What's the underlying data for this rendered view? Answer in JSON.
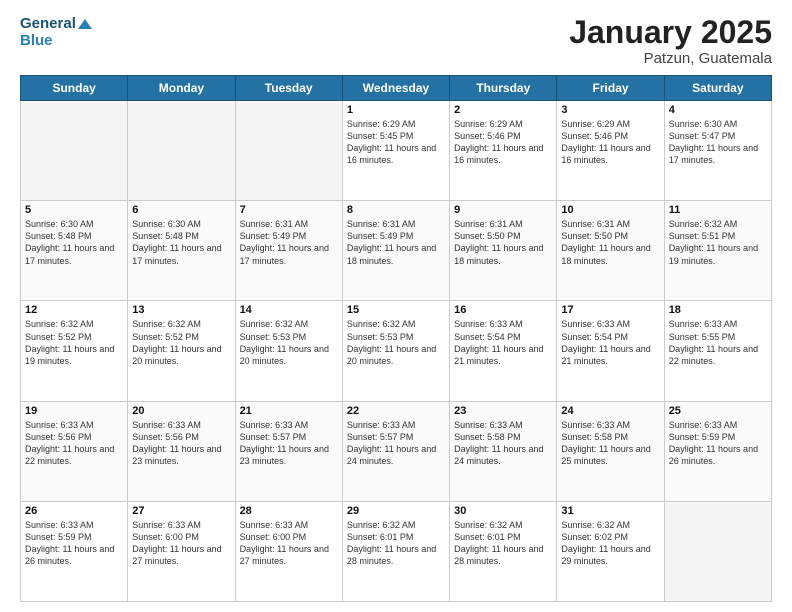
{
  "header": {
    "logo_line1": "General",
    "logo_line2": "Blue",
    "month": "January 2025",
    "location": "Patzun, Guatemala"
  },
  "weekdays": [
    "Sunday",
    "Monday",
    "Tuesday",
    "Wednesday",
    "Thursday",
    "Friday",
    "Saturday"
  ],
  "weeks": [
    [
      {
        "day": "",
        "text": ""
      },
      {
        "day": "",
        "text": ""
      },
      {
        "day": "",
        "text": ""
      },
      {
        "day": "1",
        "text": "Sunrise: 6:29 AM\nSunset: 5:45 PM\nDaylight: 11 hours\nand 16 minutes."
      },
      {
        "day": "2",
        "text": "Sunrise: 6:29 AM\nSunset: 5:46 PM\nDaylight: 11 hours\nand 16 minutes."
      },
      {
        "day": "3",
        "text": "Sunrise: 6:29 AM\nSunset: 5:46 PM\nDaylight: 11 hours\nand 16 minutes."
      },
      {
        "day": "4",
        "text": "Sunrise: 6:30 AM\nSunset: 5:47 PM\nDaylight: 11 hours\nand 17 minutes."
      }
    ],
    [
      {
        "day": "5",
        "text": "Sunrise: 6:30 AM\nSunset: 5:48 PM\nDaylight: 11 hours\nand 17 minutes."
      },
      {
        "day": "6",
        "text": "Sunrise: 6:30 AM\nSunset: 5:48 PM\nDaylight: 11 hours\nand 17 minutes."
      },
      {
        "day": "7",
        "text": "Sunrise: 6:31 AM\nSunset: 5:49 PM\nDaylight: 11 hours\nand 17 minutes."
      },
      {
        "day": "8",
        "text": "Sunrise: 6:31 AM\nSunset: 5:49 PM\nDaylight: 11 hours\nand 18 minutes."
      },
      {
        "day": "9",
        "text": "Sunrise: 6:31 AM\nSunset: 5:50 PM\nDaylight: 11 hours\nand 18 minutes."
      },
      {
        "day": "10",
        "text": "Sunrise: 6:31 AM\nSunset: 5:50 PM\nDaylight: 11 hours\nand 18 minutes."
      },
      {
        "day": "11",
        "text": "Sunrise: 6:32 AM\nSunset: 5:51 PM\nDaylight: 11 hours\nand 19 minutes."
      }
    ],
    [
      {
        "day": "12",
        "text": "Sunrise: 6:32 AM\nSunset: 5:52 PM\nDaylight: 11 hours\nand 19 minutes."
      },
      {
        "day": "13",
        "text": "Sunrise: 6:32 AM\nSunset: 5:52 PM\nDaylight: 11 hours\nand 20 minutes."
      },
      {
        "day": "14",
        "text": "Sunrise: 6:32 AM\nSunset: 5:53 PM\nDaylight: 11 hours\nand 20 minutes."
      },
      {
        "day": "15",
        "text": "Sunrise: 6:32 AM\nSunset: 5:53 PM\nDaylight: 11 hours\nand 20 minutes."
      },
      {
        "day": "16",
        "text": "Sunrise: 6:33 AM\nSunset: 5:54 PM\nDaylight: 11 hours\nand 21 minutes."
      },
      {
        "day": "17",
        "text": "Sunrise: 6:33 AM\nSunset: 5:54 PM\nDaylight: 11 hours\nand 21 minutes."
      },
      {
        "day": "18",
        "text": "Sunrise: 6:33 AM\nSunset: 5:55 PM\nDaylight: 11 hours\nand 22 minutes."
      }
    ],
    [
      {
        "day": "19",
        "text": "Sunrise: 6:33 AM\nSunset: 5:56 PM\nDaylight: 11 hours\nand 22 minutes."
      },
      {
        "day": "20",
        "text": "Sunrise: 6:33 AM\nSunset: 5:56 PM\nDaylight: 11 hours\nand 23 minutes."
      },
      {
        "day": "21",
        "text": "Sunrise: 6:33 AM\nSunset: 5:57 PM\nDaylight: 11 hours\nand 23 minutes."
      },
      {
        "day": "22",
        "text": "Sunrise: 6:33 AM\nSunset: 5:57 PM\nDaylight: 11 hours\nand 24 minutes."
      },
      {
        "day": "23",
        "text": "Sunrise: 6:33 AM\nSunset: 5:58 PM\nDaylight: 11 hours\nand 24 minutes."
      },
      {
        "day": "24",
        "text": "Sunrise: 6:33 AM\nSunset: 5:58 PM\nDaylight: 11 hours\nand 25 minutes."
      },
      {
        "day": "25",
        "text": "Sunrise: 6:33 AM\nSunset: 5:59 PM\nDaylight: 11 hours\nand 26 minutes."
      }
    ],
    [
      {
        "day": "26",
        "text": "Sunrise: 6:33 AM\nSunset: 5:59 PM\nDaylight: 11 hours\nand 26 minutes."
      },
      {
        "day": "27",
        "text": "Sunrise: 6:33 AM\nSunset: 6:00 PM\nDaylight: 11 hours\nand 27 minutes."
      },
      {
        "day": "28",
        "text": "Sunrise: 6:33 AM\nSunset: 6:00 PM\nDaylight: 11 hours\nand 27 minutes."
      },
      {
        "day": "29",
        "text": "Sunrise: 6:32 AM\nSunset: 6:01 PM\nDaylight: 11 hours\nand 28 minutes."
      },
      {
        "day": "30",
        "text": "Sunrise: 6:32 AM\nSunset: 6:01 PM\nDaylight: 11 hours\nand 28 minutes."
      },
      {
        "day": "31",
        "text": "Sunrise: 6:32 AM\nSunset: 6:02 PM\nDaylight: 11 hours\nand 29 minutes."
      },
      {
        "day": "",
        "text": ""
      }
    ]
  ]
}
